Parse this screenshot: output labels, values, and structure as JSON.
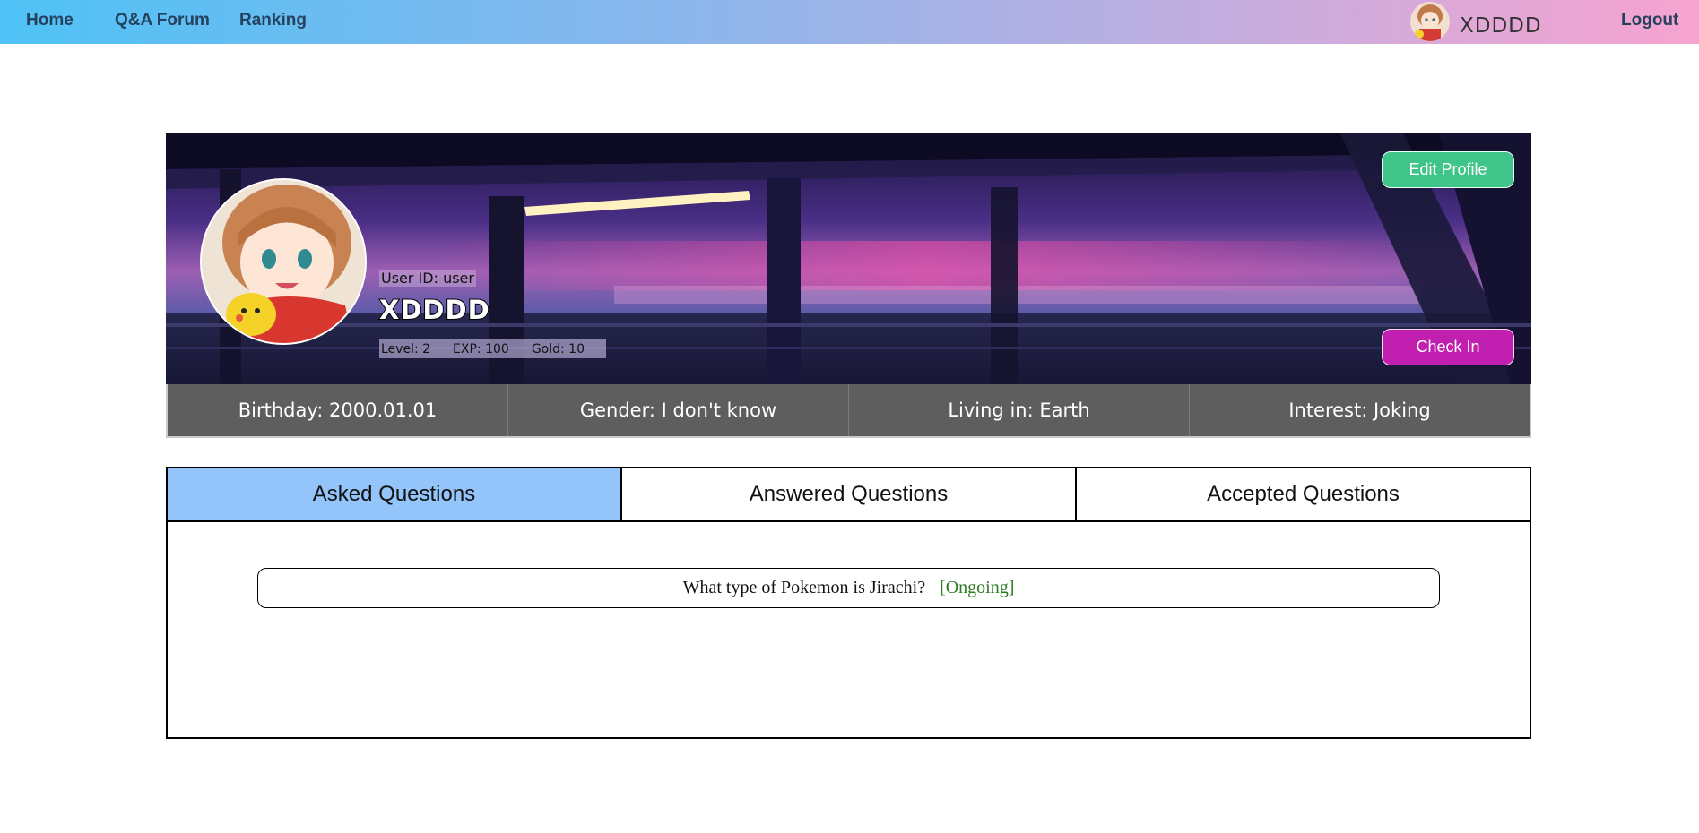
{
  "nav": {
    "home": "Home",
    "forum": "Q&A Forum",
    "ranking": "Ranking",
    "username": "XDDDD",
    "logout": "Logout"
  },
  "profile": {
    "user_id": "User ID: user",
    "name": "XDDDD",
    "level": "Level: 2",
    "exp": "EXP: 100",
    "gold": "Gold: 10",
    "edit_button": "Edit Profile",
    "checkin_button": "Check In"
  },
  "info": {
    "birthday": "Birthday: 2000.01.01",
    "gender": "Gender: I don't know",
    "living": "Living in: Earth",
    "interest": "Interest: Joking"
  },
  "tabs": [
    {
      "label": "Asked Questions",
      "active": true
    },
    {
      "label": "Answered Questions",
      "active": false
    },
    {
      "label": "Accepted Questions",
      "active": false
    }
  ],
  "questions": [
    {
      "title": "What type of Pokemon is Jirachi?",
      "status": "[Ongoing]"
    }
  ],
  "colors": {
    "nav_gradient_start": "#4fc2f5",
    "nav_gradient_end": "#f7a3cf",
    "edit_button": "#3fc48a",
    "checkin_button": "#c11fb0",
    "active_tab": "#93c5fb",
    "info_strip": "#5e5e5e",
    "status_ongoing": "#2a7a1f"
  }
}
